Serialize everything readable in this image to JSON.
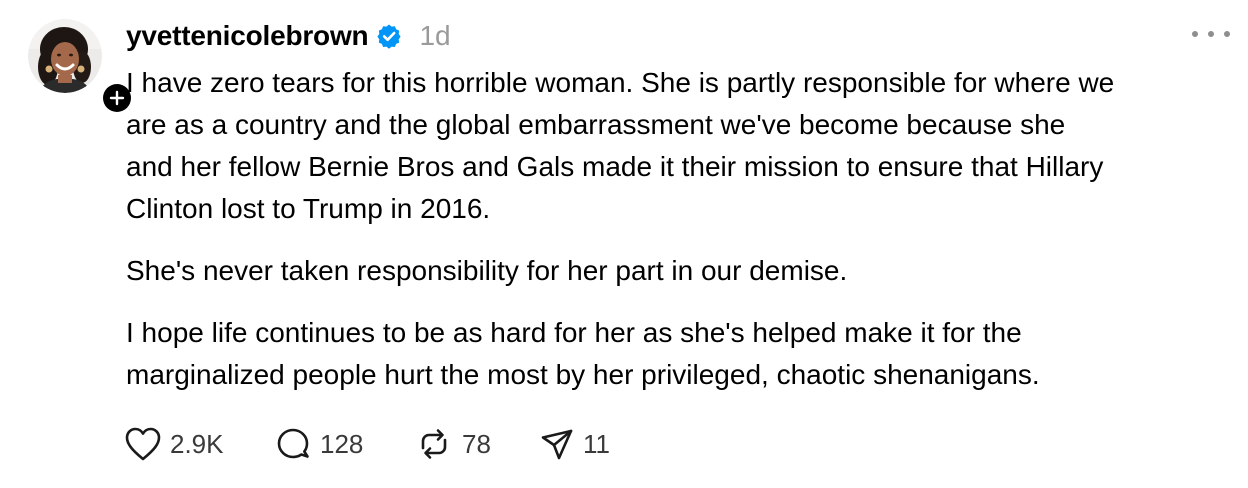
{
  "post": {
    "username": "yvettenicolebrown",
    "verified": true,
    "time": "1d",
    "paragraphs": [
      "I have zero tears for this horrible woman. She is partly responsible for where we\nare as a country and the global embarrassment we've become because she\nand her fellow Bernie Bros and Gals made it their mission to ensure that Hillary\nClinton lost to Trump in 2016.",
      "She's never taken responsibility for her part in our demise.",
      "I hope life continues to be as hard for her as she's helped make it for the\nmarginalized people hurt the most by her privileged, chaotic shenanigans."
    ],
    "actions": {
      "likes": "2.9K",
      "replies": "128",
      "reposts": "78",
      "shares": "11"
    }
  },
  "icons": {
    "avatar": "profile-photo",
    "follow": "plus-icon",
    "verified": "verified-badge-icon",
    "more": "more-options-icon",
    "like": "heart-icon",
    "reply": "comment-icon",
    "repost": "repost-icon",
    "share": "send-icon"
  },
  "colors": {
    "verified_blue": "#0095f6",
    "meta_gray": "#9a9a9a",
    "text": "#000000"
  }
}
